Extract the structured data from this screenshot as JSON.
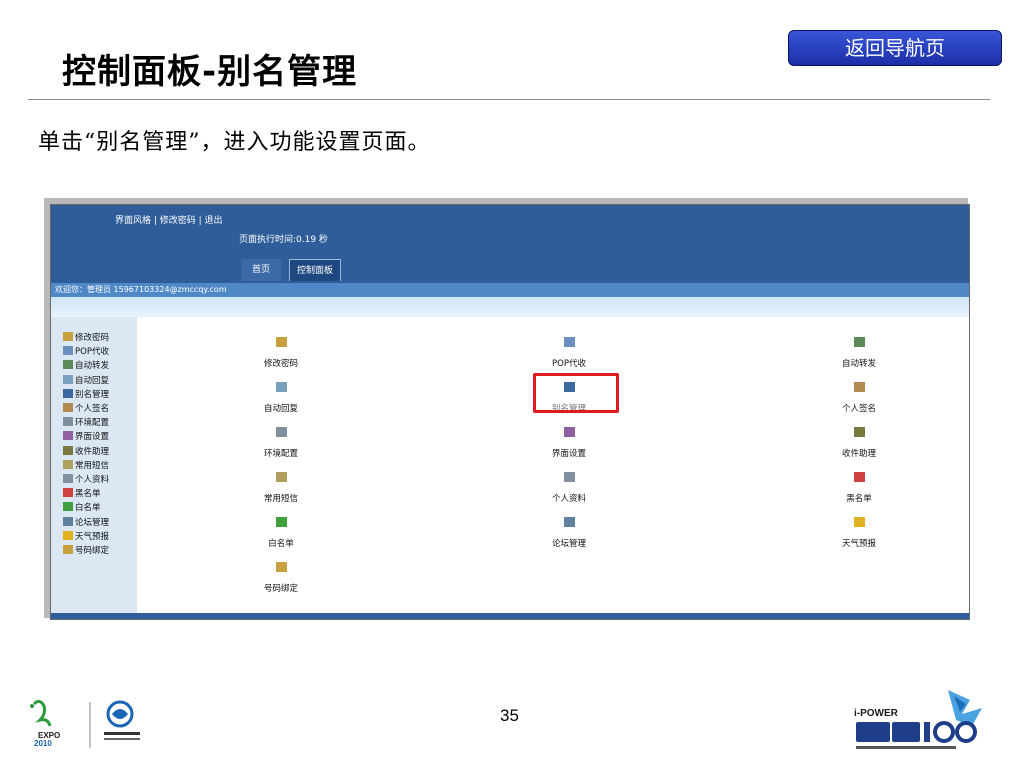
{
  "slide": {
    "title": "控制面板-别名管理",
    "nav_button": "返回导航页",
    "instruction": "单击“别名管理”，进入功能设置页面。",
    "page_number": "35"
  },
  "screenshot": {
    "header_links": "界面风格 | 修改密码 | 退出",
    "exec_time": "页面执行时间:0.19 秒",
    "tabs": [
      "首页",
      "控制面板"
    ],
    "welcome": "欢迎您：管理员 15967103324@zmccqy.com",
    "sidebar": [
      "修改密码",
      "POP代收",
      "自动转发",
      "自动回复",
      "别名管理",
      "个人签名",
      "环境配置",
      "界面设置",
      "收件助理",
      "常用短信",
      "个人资料",
      "黑名单",
      "白名单",
      "论坛管理",
      "天气预报",
      "号码绑定"
    ],
    "grid": [
      [
        "修改密码",
        "POP代收",
        "自动转发"
      ],
      [
        "自动回复",
        "别名管理",
        "个人签名"
      ],
      [
        "环境配置",
        "界面设置",
        "收件助理"
      ],
      [
        "常用短信",
        "个人资料",
        "黑名单"
      ],
      [
        "白名单",
        "论坛管理",
        "天气预报"
      ],
      [
        "号码绑定",
        "",
        ""
      ]
    ],
    "highlighted": "别名管理"
  },
  "footer": {
    "left_logo": "EXPO 2010 / 中国移动通信",
    "right_logo": "i-POWER 动力100"
  },
  "colors": {
    "header_blue": "#2f5d99",
    "highlight_red": "#e01b1b",
    "nav_button_blue": "#2a44c8"
  }
}
